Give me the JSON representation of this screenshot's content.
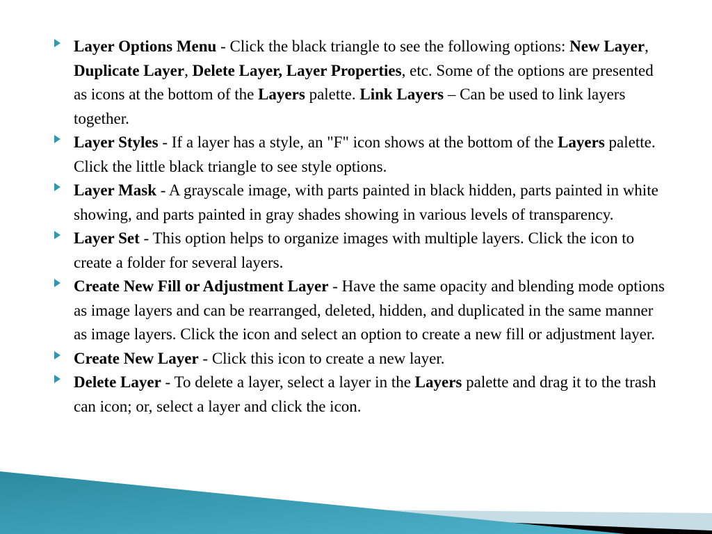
{
  "items": [
    {
      "segments": [
        {
          "t": "Layer Options Menu",
          "b": true
        },
        {
          "t": " - Click the black triangle to see the following options: "
        },
        {
          "t": "New Layer",
          "b": true
        },
        {
          "t": ", "
        },
        {
          "t": "Duplicate Layer",
          "b": true
        },
        {
          "t": ", "
        },
        {
          "t": "Delete Layer, Layer Properties",
          "b": true
        },
        {
          "t": ", etc. Some of the options are presented as icons at the bottom of the "
        },
        {
          "t": "Layers",
          "b": true
        },
        {
          "t": " palette. "
        },
        {
          "t": "Link Layers",
          "b": true
        },
        {
          "t": " – Can be used to link layers together."
        }
      ]
    },
    {
      "segments": [
        {
          "t": " "
        },
        {
          "t": "Layer Styles",
          "b": true
        },
        {
          "t": " - If a layer has a style, an \"F\" icon shows at the bottom of the "
        },
        {
          "t": "Layers",
          "b": true
        },
        {
          "t": " palette. Click the little black triangle to see style options."
        }
      ]
    },
    {
      "segments": [
        {
          "t": " "
        },
        {
          "t": "Layer Mask",
          "b": true
        },
        {
          "t": " - A grayscale image, with parts painted in black hidden, parts painted in white showing, and parts painted in gray shades showing in various levels of transparency."
        }
      ]
    },
    {
      "segments": [
        {
          "t": " "
        },
        {
          "t": "Layer Set",
          "b": true
        },
        {
          "t": " - This option helps to organize images with multiple layers. Click the icon to create a folder for several layers."
        }
      ]
    },
    {
      "segments": [
        {
          "t": " "
        },
        {
          "t": "Create New Fill or Adjustment Layer",
          "b": true
        },
        {
          "t": " - Have the same opacity and blending mode options as image layers and can be rearranged, deleted, hidden, and duplicated in the same manner as image layers. Click the icon and select an option to create a new fill or adjustment layer."
        }
      ]
    },
    {
      "segments": [
        {
          "t": " "
        },
        {
          "t": "Create New Layer",
          "b": true
        },
        {
          "t": " - Click this icon to create a new layer."
        }
      ]
    },
    {
      "segments": [
        {
          "t": "Delete Layer",
          "b": true
        },
        {
          "t": " - To delete a layer, select a layer in the "
        },
        {
          "t": "Layers",
          "b": true
        },
        {
          "t": " palette and drag it to the trash can icon; or, select a layer and click the icon."
        }
      ]
    }
  ],
  "colors": {
    "bullet": "#2e9ab0",
    "tealDark": "#1a6f85",
    "tealLight": "#4fb3c9",
    "paleBlue": "#c7dde6",
    "black": "#000000"
  }
}
